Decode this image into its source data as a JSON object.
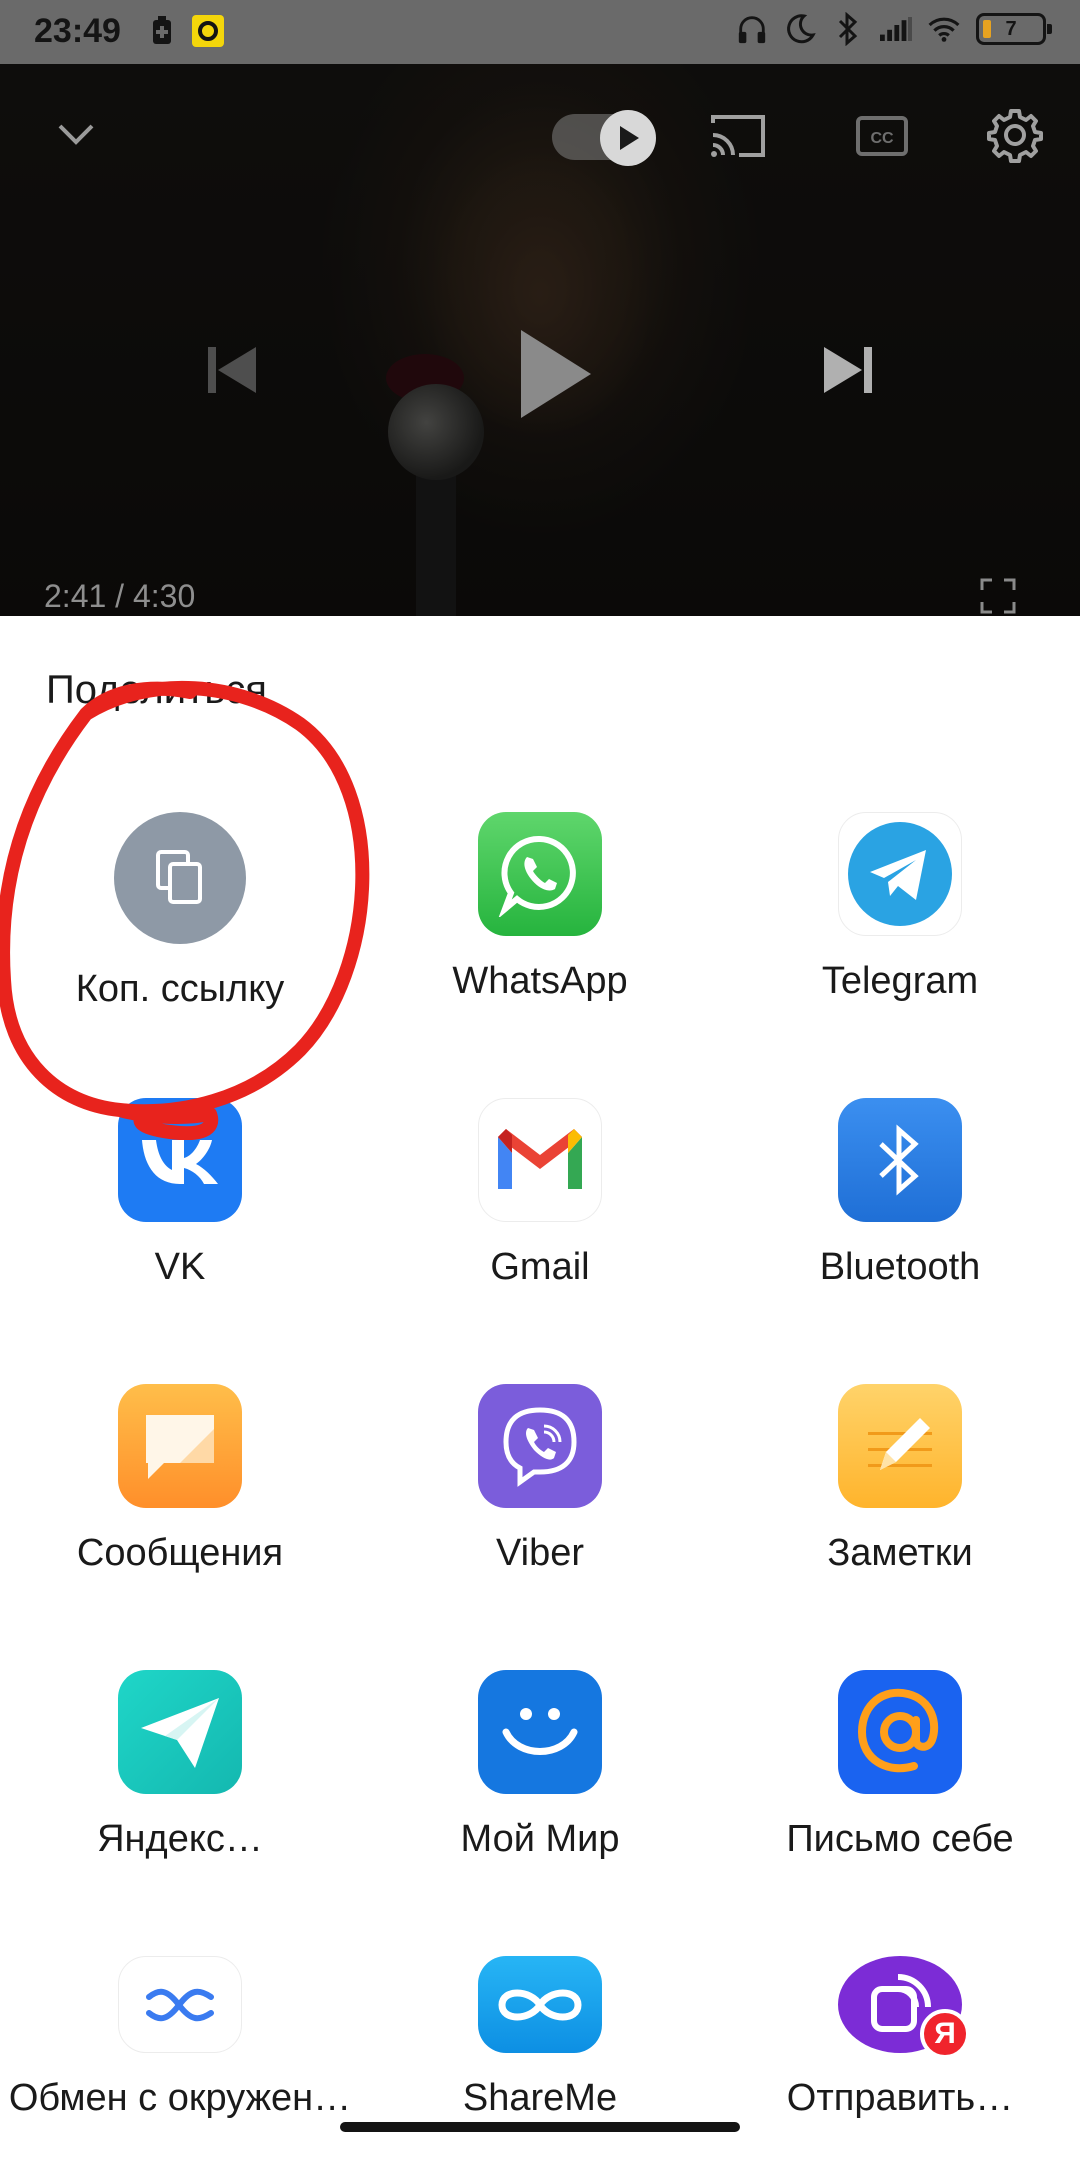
{
  "status_bar": {
    "time": "23:49",
    "battery_level": "7",
    "icons": [
      "battery-saver-icon",
      "recorder-icon",
      "headphones-icon",
      "do-not-disturb-icon",
      "bluetooth-icon",
      "signal-icon",
      "wifi-icon",
      "battery-icon"
    ]
  },
  "player": {
    "position": "2:41",
    "duration": "4:30",
    "time_text": "2:41 / 4:30",
    "controls": [
      "collapse-icon",
      "autoplay-toggle",
      "cast-icon",
      "captions-icon",
      "settings-icon",
      "previous-icon",
      "play-icon",
      "next-icon",
      "fullscreen-icon"
    ],
    "autoplay_on": true
  },
  "share_sheet": {
    "title": "Поделиться",
    "apps": [
      {
        "label": "Коп. ссылку",
        "icon": "copy-link-icon"
      },
      {
        "label": "WhatsApp",
        "icon": "whatsapp-icon"
      },
      {
        "label": "Telegram",
        "icon": "telegram-icon"
      },
      {
        "label": "VK",
        "icon": "vk-icon"
      },
      {
        "label": "Gmail",
        "icon": "gmail-icon"
      },
      {
        "label": "Bluetooth",
        "icon": "bluetooth-icon"
      },
      {
        "label": "Сообщения",
        "icon": "messages-icon"
      },
      {
        "label": "Viber",
        "icon": "viber-icon"
      },
      {
        "label": "Заметки",
        "icon": "notes-icon"
      },
      {
        "label": "Яндекс…",
        "icon": "yandex-icon"
      },
      {
        "label": "Мой Мир",
        "icon": "moi-mir-icon"
      },
      {
        "label": "Письмо себе",
        "icon": "mail-to-self-icon"
      },
      {
        "label": "Обмен с окружен…",
        "icon": "nearby-share-icon"
      },
      {
        "label": "ShareMe",
        "icon": "shareme-icon"
      },
      {
        "label": "Отправить…",
        "icon": "send-icon"
      }
    ]
  },
  "colors": {
    "status_bar": "#6a6a6a",
    "annotation_stroke": "#e8231d",
    "sheet_background": "#ffffff"
  }
}
